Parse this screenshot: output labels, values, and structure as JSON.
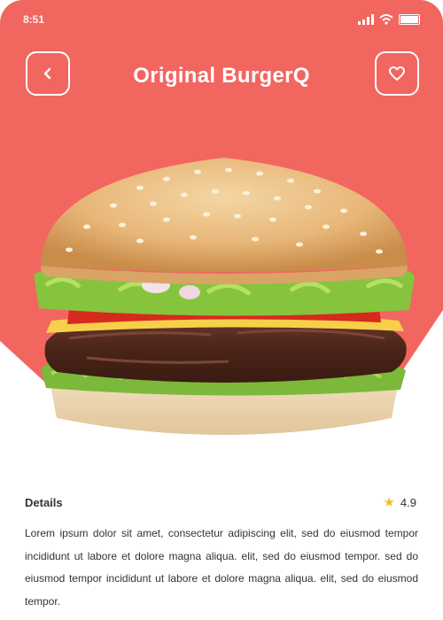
{
  "status_bar": {
    "time": "8:51"
  },
  "header": {
    "title": "Original BurgerQ"
  },
  "icons": {
    "back": "chevron-left-icon",
    "favorite": "heart-icon",
    "rating": "star-icon"
  },
  "colors": {
    "hero": "#f26660",
    "star": "#f4c020"
  },
  "details": {
    "label": "Details",
    "rating": "4.9",
    "description": "Lorem ipsum dolor sit amet, consectetur adipiscing elit, sed do eiusmod tempor incididunt ut labore et dolore magna aliqua. elit, sed do eiusmod tempor. sed do eiusmod tempor incididunt ut labore et dolore magna aliqua. elit, sed do eiusmod tempor."
  }
}
